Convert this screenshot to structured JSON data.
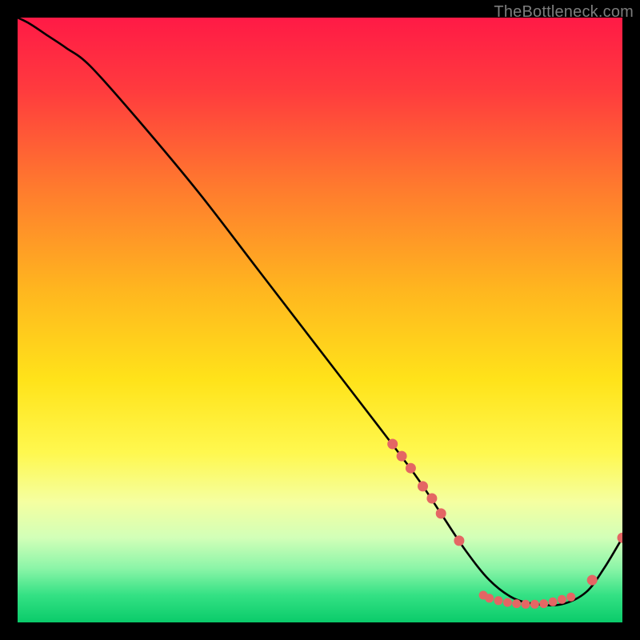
{
  "watermark": "TheBottleneck.com",
  "colors": {
    "background": "#000000",
    "line": "#000000",
    "marker": "#e46664",
    "gradient_stops": [
      {
        "offset": 0.0,
        "color": "#ff1a46"
      },
      {
        "offset": 0.12,
        "color": "#ff3b3e"
      },
      {
        "offset": 0.28,
        "color": "#ff7a2e"
      },
      {
        "offset": 0.45,
        "color": "#ffb61f"
      },
      {
        "offset": 0.6,
        "color": "#ffe31a"
      },
      {
        "offset": 0.72,
        "color": "#fff84f"
      },
      {
        "offset": 0.8,
        "color": "#f5ffa0"
      },
      {
        "offset": 0.86,
        "color": "#d2ffb8"
      },
      {
        "offset": 0.91,
        "color": "#8cf5a8"
      },
      {
        "offset": 0.955,
        "color": "#34e184"
      },
      {
        "offset": 1.0,
        "color": "#0acb6a"
      }
    ]
  },
  "chart_data": {
    "type": "line",
    "xlabel": "",
    "ylabel": "",
    "xlim": [
      0,
      100
    ],
    "ylim": [
      0,
      100
    ],
    "title": "",
    "series": [
      {
        "name": "curve",
        "x": [
          0,
          2,
          5,
          8,
          12,
          20,
          30,
          40,
          50,
          60,
          66,
          70,
          74,
          78,
          82,
          86,
          90,
          94,
          97,
          100
        ],
        "y": [
          100,
          99,
          97,
          95,
          92,
          83,
          71,
          58,
          45,
          32,
          24,
          18,
          12,
          7,
          4,
          3,
          3,
          5,
          9,
          14
        ]
      }
    ],
    "markers": [
      {
        "x": 62.0,
        "y": 29.5
      },
      {
        "x": 63.5,
        "y": 27.5
      },
      {
        "x": 65.0,
        "y": 25.5
      },
      {
        "x": 67.0,
        "y": 22.5
      },
      {
        "x": 68.5,
        "y": 20.5
      },
      {
        "x": 70.0,
        "y": 18.0
      },
      {
        "x": 73.0,
        "y": 13.5
      },
      {
        "x": 77.0,
        "y": 4.5
      },
      {
        "x": 78.0,
        "y": 4.0
      },
      {
        "x": 79.5,
        "y": 3.6
      },
      {
        "x": 81.0,
        "y": 3.3
      },
      {
        "x": 82.5,
        "y": 3.1
      },
      {
        "x": 84.0,
        "y": 3.0
      },
      {
        "x": 85.5,
        "y": 3.0
      },
      {
        "x": 87.0,
        "y": 3.1
      },
      {
        "x": 88.5,
        "y": 3.4
      },
      {
        "x": 90.0,
        "y": 3.8
      },
      {
        "x": 91.5,
        "y": 4.2
      },
      {
        "x": 95.0,
        "y": 7.0
      },
      {
        "x": 100.0,
        "y": 14.0
      }
    ]
  }
}
